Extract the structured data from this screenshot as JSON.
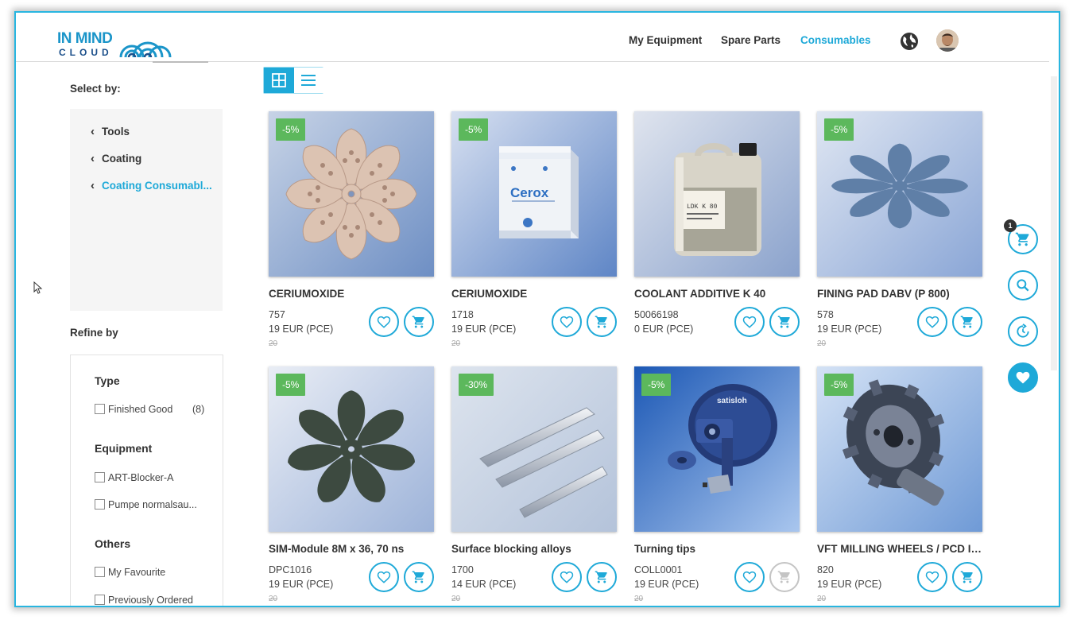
{
  "brand": {
    "line1": "IN MIND",
    "line2": "CLOUD"
  },
  "nav": {
    "items": [
      {
        "label": "My Equipment"
      },
      {
        "label": "Spare Parts"
      },
      {
        "label": "Consumables"
      }
    ],
    "active": "Consumables"
  },
  "sidebar": {
    "select_by": "Select by:",
    "categories": [
      {
        "label": "Tools"
      },
      {
        "label": "Coating"
      },
      {
        "label": "Coating Consumabl..."
      }
    ],
    "refine_by": "Refine by",
    "groups": {
      "type": {
        "title": "Type",
        "options": [
          {
            "label": "Finished Good",
            "count": "(8)"
          }
        ]
      },
      "equipment": {
        "title": "Equipment",
        "options": [
          {
            "label": "ART-Blocker-A"
          },
          {
            "label": "Pumpe normalsau..."
          }
        ]
      },
      "others": {
        "title": "Others",
        "options": [
          {
            "label": "My Favourite"
          },
          {
            "label": "Previously Ordered"
          }
        ]
      }
    }
  },
  "view_mode": "grid",
  "products": [
    {
      "name": "CERIUMOXIDE",
      "id": "757",
      "price": "19 EUR (PCE)",
      "old_price": "20",
      "badge": "-5%",
      "cart_enabled": true
    },
    {
      "name": "CERIUMOXIDE",
      "id": "1718",
      "price": "19 EUR (PCE)",
      "old_price": "20",
      "badge": "-5%",
      "cart_enabled": true
    },
    {
      "name": "COOLANT ADDITIVE K 40",
      "id": "50066198",
      "price": "0 EUR (PCE)",
      "old_price": "",
      "badge": "",
      "cart_enabled": true,
      "label_text": "LDK K 80"
    },
    {
      "name": "FINING PAD DABV (P 800)",
      "id": "578",
      "price": "19 EUR (PCE)",
      "old_price": "20",
      "badge": "-5%",
      "cart_enabled": true
    },
    {
      "name": "SIM-Module 8M x 36, 70 ns",
      "id": "DPC1016",
      "price": "19 EUR (PCE)",
      "old_price": "20",
      "badge": "-5%",
      "cart_enabled": true
    },
    {
      "name": "Surface blocking alloys",
      "id": "1700",
      "price": "14 EUR (PCE)",
      "old_price": "20",
      "badge": "-30%",
      "cart_enabled": true
    },
    {
      "name": "Turning tips",
      "id": "COLL0001",
      "price": "19 EUR (PCE)",
      "old_price": "20",
      "badge": "-5%",
      "cart_enabled": false,
      "label_text": "satisloh"
    },
    {
      "name": "VFT MILLING WHEELS / PCD IN...",
      "id": "820",
      "price": "19 EUR (PCE)",
      "old_price": "20",
      "badge": "-5%",
      "cart_enabled": true
    }
  ],
  "box_brand": "Cerox",
  "floating": {
    "cart_count": "1"
  },
  "colors": {
    "accent": "#1ea9d8",
    "badge": "#5cb85c",
    "frame": "#29b6e0"
  },
  "icons": [
    "globe-icon",
    "heart-icon",
    "cart-icon",
    "search-icon",
    "history-icon",
    "grid-icon",
    "list-icon",
    "chevron-left-icon",
    "cursor-icon"
  ]
}
